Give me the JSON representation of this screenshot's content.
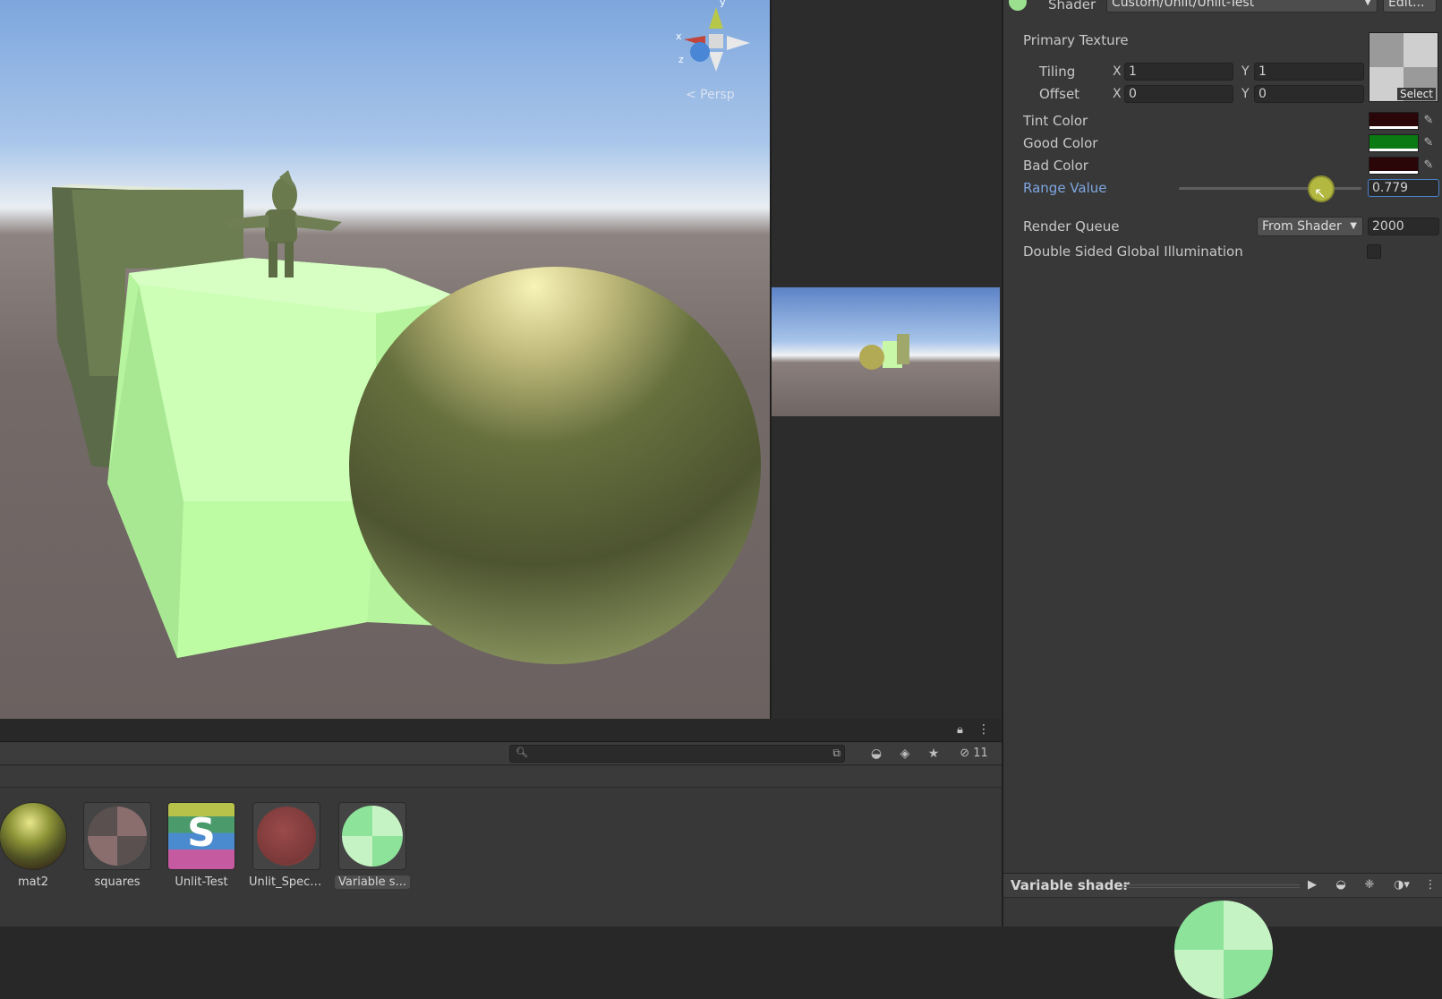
{
  "scene": {
    "projection_label": "< Persp",
    "gizmo_axes": [
      "x",
      "y",
      "z"
    ],
    "colors": {
      "sky_top": "#7da6dd",
      "ground": "#6b6160",
      "cube_green": "#b9f7a0",
      "sphere_olive": "#5a5e34"
    }
  },
  "inspector": {
    "shader_label": "Shader",
    "shader_value": "Custom/Unlit/Unlit-Test",
    "edit_label": "Edit...",
    "primary_texture_label": "Primary Texture",
    "tiling_label": "Tiling",
    "offset_label": "Offset",
    "tiling_x": "1",
    "tiling_y": "1",
    "offset_x": "0",
    "offset_y": "0",
    "axis_x": "X",
    "axis_y": "Y",
    "texture_select_label": "Select",
    "tint_color_label": "Tint Color",
    "good_color_label": "Good Color",
    "bad_color_label": "Bad Color",
    "range_value_label": "Range Value",
    "range_value": "0.779",
    "range_fraction": 0.779,
    "render_queue_label": "Render Queue",
    "render_queue_mode": "From Shader",
    "render_queue_value": "2000",
    "double_sided_gi_label": "Double Sided Global Illumination",
    "colors": {
      "tint": "#2a0608",
      "good": "#0b7a12",
      "bad": "#2a0608",
      "active_label": "#7ea6e0"
    }
  },
  "preview": {
    "title": "Variable shader"
  },
  "project": {
    "hidden_count": "11",
    "assets": [
      {
        "name": "mat2",
        "icon": "sphere-material-icon"
      },
      {
        "name": "squares",
        "icon": "checker-material-icon"
      },
      {
        "name": "Unlit-Test",
        "icon": "shader-file-icon"
      },
      {
        "name": "Unlit_Speci...",
        "icon": "red-material-icon"
      },
      {
        "name": "Variable s...",
        "icon": "green-material-icon",
        "selected": true
      }
    ]
  }
}
